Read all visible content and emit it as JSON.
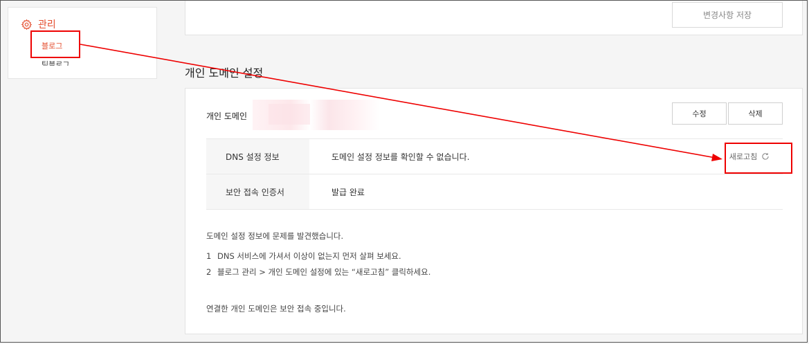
{
  "sidebar": {
    "header": "관리",
    "items": [
      {
        "label": "블로그"
      },
      {
        "label": "팀블로그"
      }
    ]
  },
  "top_card": {
    "save_label": "변경사항 저장"
  },
  "section_title": "개인 도메인 설정",
  "domain": {
    "label": "개인 도메인",
    "edit_label": "수정",
    "delete_label": "삭제"
  },
  "table": {
    "rows": [
      {
        "key": "DNS 설정 정보",
        "value": "도메인 설정 정보를 확인할 수 없습니다."
      },
      {
        "key": "보안 접속 인증서",
        "value": "발급 완료"
      }
    ],
    "refresh_label": "새로고침"
  },
  "notes": {
    "title": "도메인 설정 정보에 문제를 발견했습니다.",
    "steps": [
      {
        "num": "1",
        "text": "DNS 서비스에 가셔서 이상이 없는지 먼저 살펴 보세요."
      },
      {
        "num": "2",
        "text": "블로그 관리 > 개인 도메인 설정에 있는 “새로고침” 클릭하세요."
      }
    ],
    "footer": "연결한 개인 도메인은 보안 접속 중입니다."
  },
  "colors": {
    "accent": "#e44d2e",
    "annotation": "#e00000"
  },
  "icons": [
    "gear-icon",
    "refresh-icon"
  ]
}
